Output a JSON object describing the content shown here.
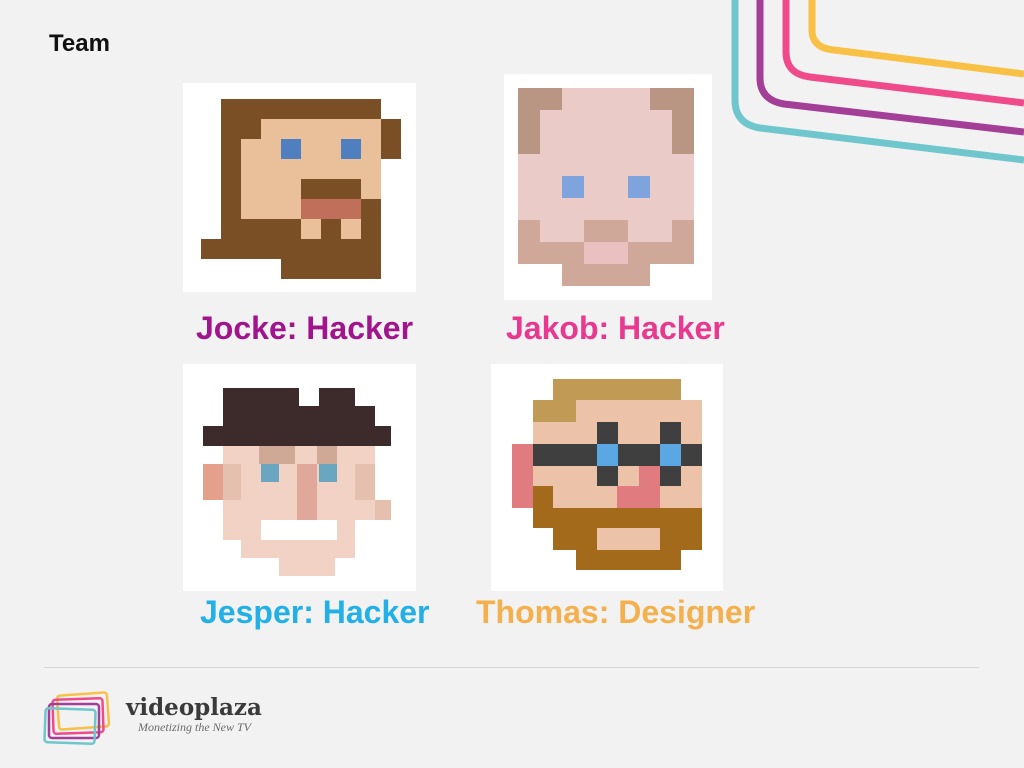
{
  "slide": {
    "title": "Team"
  },
  "team": [
    {
      "name": "Jocke: Hacker",
      "color": "#a0148c"
    },
    {
      "name": "Jakob: Hacker",
      "color": "#e8388f"
    },
    {
      "name": "Jesper: Hacker",
      "color": "#22b0e6"
    },
    {
      "name": "Thomas: Designer",
      "color": "#f4b04c"
    }
  ],
  "brand": {
    "name": "videoplaza",
    "tagline": "Monetizing the New TV",
    "colors": [
      "#f8c146",
      "#ef4b8b",
      "#a43f98",
      "#6fc6cd"
    ]
  },
  "icons": {
    "logo": "stacked-screens-logo",
    "avatars": [
      "pixel-bearded-face",
      "pixel-pig-face",
      "pixel-hat-face",
      "pixel-glasses-face"
    ]
  }
}
